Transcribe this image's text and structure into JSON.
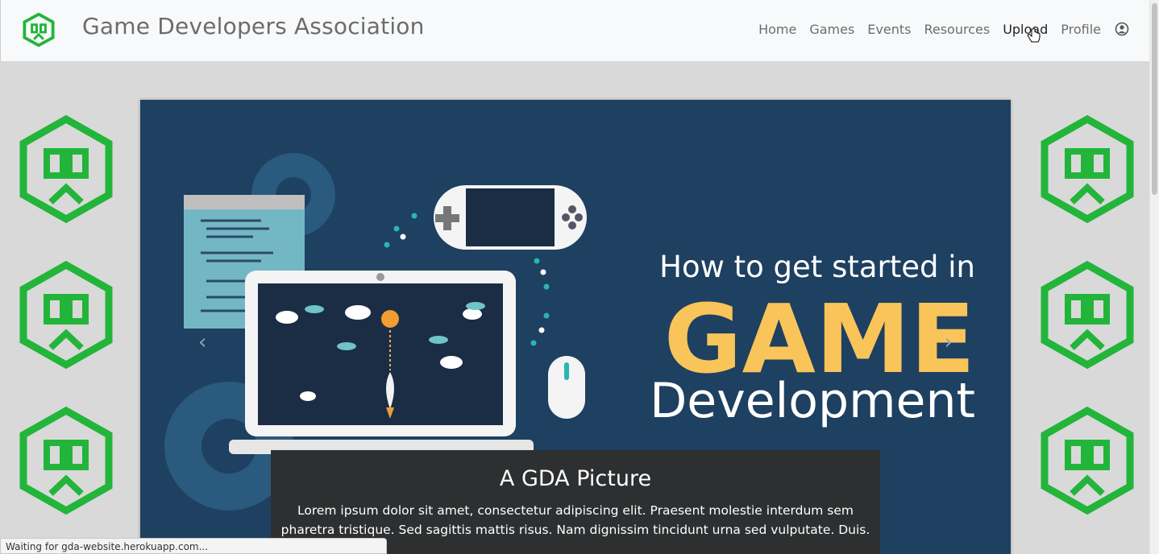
{
  "navbar": {
    "brand_title": "Game Developers Association",
    "links": [
      "Home",
      "Games",
      "Events",
      "Resources",
      "Upload",
      "Profile"
    ],
    "active_link": "Upload"
  },
  "carousel": {
    "banner_line1": "How to get started in",
    "banner_line2": "GAME",
    "banner_line3": "Development",
    "prev_glyph": "‹",
    "next_glyph": "›",
    "caption_title": "A GDA Picture",
    "caption_text": "Lorem ipsum dolor sit amet, consectetur adipiscing elit. Praesent molestie interdum sem pharetra tristique. Sed sagittis mattis risus. Nam dignissim tincidunt urna sed vulputate. Duis."
  },
  "status_bar": {
    "text": "Waiting for gda-website.herokuapp.com..."
  },
  "colors": {
    "brand_green": "#22b53a",
    "banner_bg": "#1e4061",
    "game_yellow": "#f9c45a",
    "caption_bg": "#2e2f30"
  },
  "icons": [
    "gda-logo-icon",
    "user-circle-icon",
    "chevron-left-icon",
    "chevron-right-icon",
    "hand-cursor-icon"
  ]
}
